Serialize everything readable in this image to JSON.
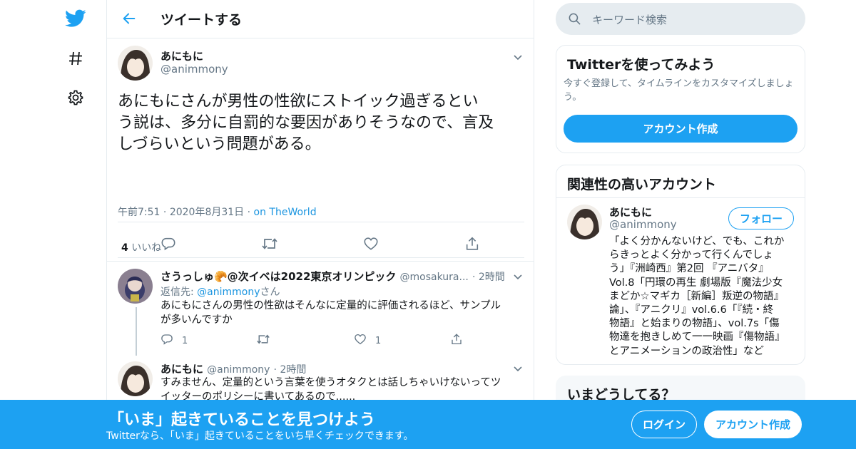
{
  "header": {
    "title": "ツイートする"
  },
  "tweet": {
    "name": "あにもに",
    "handle": "@animmony",
    "text_lines": [
      "あにもにさんが男性の性欲にストイック過ぎるとい",
      "う説は、多分に自罰的な要因がありそうなので、言及",
      "しづらいという問題がある。"
    ],
    "time": "午前7:51",
    "date": "2020年8月31日",
    "source": "on TheWorld",
    "likes_count": "4",
    "likes_label": "いいね"
  },
  "replies": [
    {
      "name": "さうっしゅ🥐@次イベは2022東京オリンピック",
      "handle": "@mosakura...",
      "time": "2時間",
      "reply_to_prefix": "返信先: ",
      "reply_to_handle": "@animmony",
      "reply_to_suffix": "さん",
      "text_lines": [
        "あにもにさんの男性の性欲はそんなに定量的に評価されるほど、サンプル",
        "が多いんですか"
      ],
      "reply_count": "1",
      "like_count": "1"
    },
    {
      "name": "あにもに",
      "handle": "@animmony",
      "time": "2時間",
      "text_lines": [
        "すみません、定量的という言葉を使うオタクとは話しちゃいけないってツ",
        "イッターのポリシーに書いてあるので......"
      ]
    }
  ],
  "sidebar": {
    "search_placeholder": "キーワード検索",
    "signup_card": {
      "title": "Twitterを使ってみよう",
      "subtitle_lines": [
        "今すぐ登録して、タイムラインをカスタマイズしましょ",
        "う。"
      ],
      "button": "アカウント作成"
    },
    "related": {
      "title": "関連性の高いアカウント",
      "name": "あにもに",
      "handle": "@animmony",
      "follow": "フォロー",
      "bio_lines": [
        "「よく分かんないけど、でも、これか",
        "らきっとよく分かって行くんでしょ",
        "う」『洲崎西』第2回 『アニバタ』",
        "Vol.8「円環の再生 劇場版『魔法少女",
        "まどか☆マギカ［新編］叛逆の物語』",
        "論」、『アニクリ』vol.6.6「『続・終",
        "物語』と始まりの物語」、vol.7s「傷",
        "物達を抱きしめて一一映画『傷物語』",
        "とアニメーションの政治性」など"
      ]
    },
    "trends": {
      "title": "いまどうしてる？"
    }
  },
  "banner": {
    "title": "「いま」起きていることを見つけよう",
    "subtitle": "Twitterなら、「いま」起きていることをいち早くチェックできます。",
    "login": "ログイン",
    "signup": "アカウント作成"
  },
  "colors": {
    "accent": "#1da1f2",
    "link": "#1b95e0",
    "muted": "#657786",
    "border": "#e6ecf0"
  },
  "icons": [
    "twitter-bird-icon",
    "hashtag-icon",
    "settings-gear-icon",
    "back-arrow-icon",
    "chevron-down-icon",
    "reply-icon",
    "retweet-icon",
    "like-heart-icon",
    "share-icon",
    "search-icon"
  ]
}
